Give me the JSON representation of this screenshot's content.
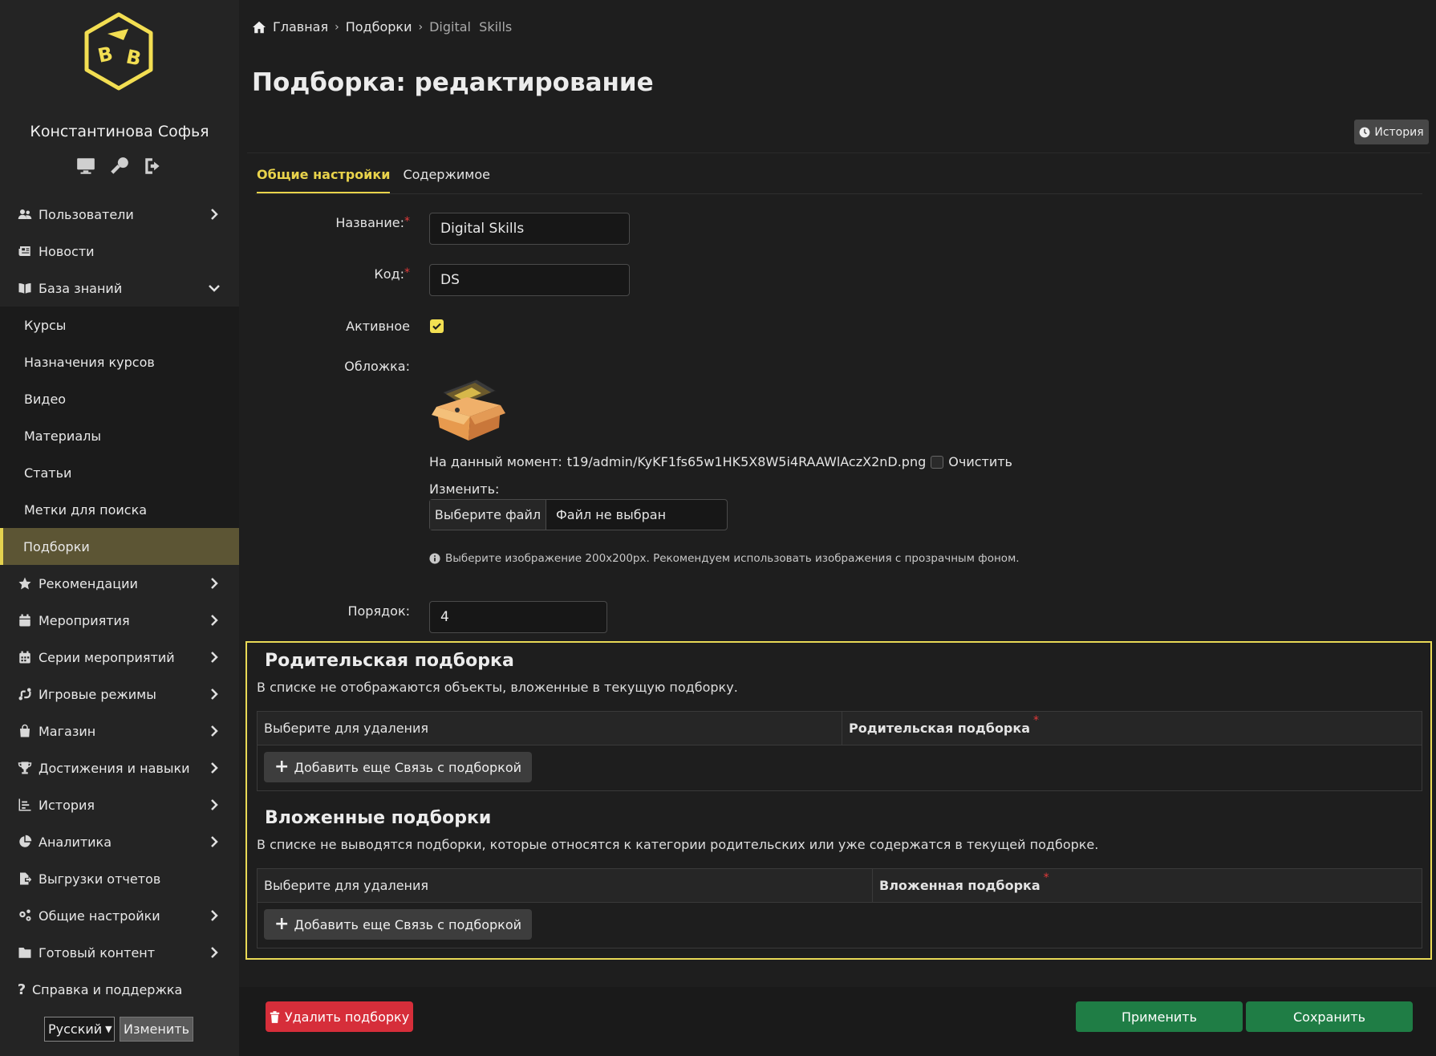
{
  "user": {
    "name": "Константинова Софья"
  },
  "sidebar": {
    "items": [
      {
        "label": "Пользователи",
        "icon": "users-icon"
      },
      {
        "label": "Новости",
        "icon": "newspaper-icon"
      },
      {
        "label": "База знаний",
        "icon": "book-icon",
        "expanded": true
      }
    ],
    "knowledge_sub": [
      {
        "label": "Курсы"
      },
      {
        "label": "Назначения курсов"
      },
      {
        "label": "Видео"
      },
      {
        "label": "Материалы"
      },
      {
        "label": "Статьи"
      },
      {
        "label": "Метки для поиска"
      },
      {
        "label": "Подборки",
        "active": true
      }
    ],
    "items2": [
      {
        "label": "Рекомендации",
        "icon": "star-icon"
      },
      {
        "label": "Мероприятия",
        "icon": "calendar-icon"
      },
      {
        "label": "Серии мероприятий",
        "icon": "calendar-grid-icon"
      },
      {
        "label": "Игровые режимы",
        "icon": "route-icon"
      },
      {
        "label": "Магазин",
        "icon": "shopping-bag-icon"
      },
      {
        "label": "Достижения и навыки",
        "icon": "trophy-icon"
      },
      {
        "label": "История",
        "icon": "chart-icon"
      },
      {
        "label": "Аналитика",
        "icon": "pie-chart-icon"
      },
      {
        "label": "Выгрузки отчетов",
        "icon": "file-export-icon"
      },
      {
        "label": "Общие настройки",
        "icon": "cogs-icon"
      },
      {
        "label": "Готовый контент",
        "icon": "folder-icon"
      },
      {
        "label": "Справка и поддержка",
        "icon": "question-icon"
      }
    ]
  },
  "language": {
    "selected": "Русский",
    "change_label": "Изменить"
  },
  "breadcrumb": {
    "home": "Главная",
    "section": "Подборки",
    "current": "Digital  Skills"
  },
  "page": {
    "title": "Подборка: редактирование",
    "history_label": "История"
  },
  "tabs": [
    {
      "label": "Общие настройки",
      "active": true
    },
    {
      "label": "Содержимое"
    }
  ],
  "form": {
    "name_label": "Название:",
    "name_value": "Digital Skills",
    "code_label": "Код:",
    "code_value": "DS",
    "active_label": "Активное",
    "active_checked": true,
    "cover_label": "Обложка:",
    "current_prefix": "На данный момент:",
    "current_file": "t19/admin/KyKF1fs65w1HK5X8W5i4RAAWlAczX2nD.png",
    "clear_label": "Очистить",
    "change_label": "Изменить:",
    "file_button": "Выберите файл",
    "file_none": "Файл не выбран",
    "hint": "Выберите изображение 200х200px. Рекомендуем использовать изображения с прозрачным фоном.",
    "order_label": "Порядок:",
    "order_value": "4"
  },
  "parent_section": {
    "title": "Родительская подборка",
    "description": "В списке не отображаются объекты, вложенные в текущую подборку.",
    "col_delete": "Выберите для удаления",
    "col_item": "Родительская подборка",
    "add_label": "Добавить еще Связь с подборкой"
  },
  "nested_section": {
    "title": "Вложенные подборки",
    "description": "В списке не выводятся подборки, которые относятся к категории родительских или уже содержатся в текущей подборке.",
    "col_delete": "Выберите для удаления",
    "col_item": "Вложенная подборка",
    "add_label": "Добавить еще Связь с подборкой"
  },
  "footer": {
    "delete_label": "Удалить подборку",
    "apply_label": "Применить",
    "save_label": "Сохранить"
  },
  "colors": {
    "accent": "#e9d34b",
    "danger": "#d62e3a",
    "success": "#1f7d45",
    "active_bg": "#5c5534"
  }
}
